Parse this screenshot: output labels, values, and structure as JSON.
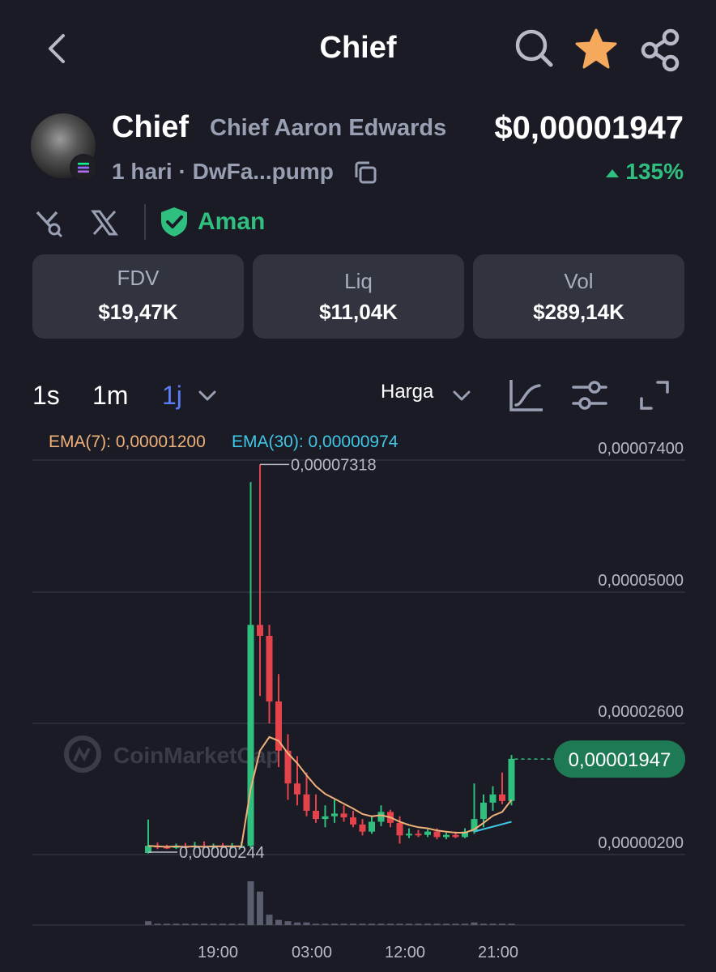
{
  "header": {
    "title": "Chief"
  },
  "token": {
    "symbol": "Chief",
    "name": "Chief Aaron Edwards",
    "price": "$0,00001947",
    "age": "1 hari",
    "separator": " · ",
    "address": "DwFa...pump",
    "change": "135%",
    "safety_label": "Aman"
  },
  "stats": [
    {
      "label": "FDV",
      "value": "$19,47K"
    },
    {
      "label": "Liq",
      "value": "$11,04K"
    },
    {
      "label": "Vol",
      "value": "$289,14K"
    }
  ],
  "intervals": [
    {
      "label": "1s",
      "active": false
    },
    {
      "label": "1m",
      "active": false
    },
    {
      "label": "1j",
      "active": true
    }
  ],
  "chart_type_label": "Harga",
  "ema": {
    "ema7": "EMA(7): 0,00001200",
    "ema30": "EMA(30): 0,00000974"
  },
  "colors": {
    "up": "#2fbf7e",
    "down": "#e4434c",
    "ema7": "#f0b07a",
    "ema30": "#3fc7e6",
    "accent": "#5b7cf7",
    "star": "#f4a95d",
    "badge": "#1e7a55"
  },
  "watermark": "CoinMarketCap",
  "icons": [
    "back-icon",
    "search-icon",
    "star-icon",
    "share-icon",
    "copy-icon",
    "audit-icon",
    "x-icon",
    "shield-check-icon",
    "chevron-down-icon",
    "line-chart-icon",
    "settings-sliders-icon",
    "expand-icon"
  ],
  "chart_data": {
    "type": "candlestick",
    "y_ticks": [
      "0,00007400",
      "0,00005000",
      "0,00002600",
      "0,00000200"
    ],
    "y_tick_values": [
      7.4e-05,
      5e-05,
      2.6e-05,
      2e-06
    ],
    "x_ticks": [
      "19:00",
      "03:00",
      "12:00",
      "21:00"
    ],
    "high_label": "0,00007318",
    "low_label": "0,00000244",
    "current_price_label": "0,00001947",
    "ylim": [
      2e-06,
      7.4e-05
    ],
    "candles": [
      {
        "o": 2.3e-06,
        "h": 8.4e-06,
        "l": 2.2e-06,
        "c": 3.6e-06,
        "v": 3
      },
      {
        "o": 3.6e-06,
        "h": 4.2e-06,
        "l": 3e-06,
        "c": 3.4e-06,
        "v": 1
      },
      {
        "o": 3.4e-06,
        "h": 3.8e-06,
        "l": 3e-06,
        "c": 3.3e-06,
        "v": 1
      },
      {
        "o": 3.3e-06,
        "h": 4e-06,
        "l": 3e-06,
        "c": 3.5e-06,
        "v": 1
      },
      {
        "o": 3.5e-06,
        "h": 4.1e-06,
        "l": 3.1e-06,
        "c": 3.3e-06,
        "v": 1
      },
      {
        "o": 3.3e-06,
        "h": 4.3e-06,
        "l": 3e-06,
        "c": 3.6e-06,
        "v": 1
      },
      {
        "o": 3.6e-06,
        "h": 4.4e-06,
        "l": 3.1e-06,
        "c": 3.3e-06,
        "v": 1
      },
      {
        "o": 3.3e-06,
        "h": 4e-06,
        "l": 3e-06,
        "c": 3.6e-06,
        "v": 1
      },
      {
        "o": 3.6e-06,
        "h": 4.1e-06,
        "l": 3.3e-06,
        "c": 3.5e-06,
        "v": 1
      },
      {
        "o": 3.5e-06,
        "h": 4.1e-06,
        "l": 3.1e-06,
        "c": 3.6e-06,
        "v": 1
      },
      {
        "o": 3.6e-06,
        "h": 4.3e-06,
        "l": 3.2e-06,
        "c": 3.6e-06,
        "v": 1
      },
      {
        "o": 3.6e-06,
        "h": 7e-05,
        "l": 3.2e-06,
        "c": 4.4e-05,
        "v": 34
      },
      {
        "o": 4.4e-05,
        "h": 7.32e-05,
        "l": 3.1e-05,
        "c": 4.2e-05,
        "v": 26
      },
      {
        "o": 4.2e-05,
        "h": 4.4e-05,
        "l": 2.6e-05,
        "c": 3e-05,
        "v": 8
      },
      {
        "o": 3e-05,
        "h": 3.5e-05,
        "l": 1.8e-05,
        "c": 2.1e-05,
        "v": 4
      },
      {
        "o": 2.1e-05,
        "h": 2.4e-05,
        "l": 1.2e-05,
        "c": 1.5e-05,
        "v": 3
      },
      {
        "o": 1.5e-05,
        "h": 2e-05,
        "l": 1.1e-05,
        "c": 1.3e-05,
        "v": 2
      },
      {
        "o": 1.3e-05,
        "h": 1.7e-05,
        "l": 9e-06,
        "c": 1e-05,
        "v": 2
      },
      {
        "o": 1e-05,
        "h": 1.3e-05,
        "l": 7.8e-06,
        "c": 8.5e-06,
        "v": 1
      },
      {
        "o": 8.5e-06,
        "h": 1.1e-05,
        "l": 7e-06,
        "c": 9e-06,
        "v": 1
      },
      {
        "o": 9e-06,
        "h": 1.2e-05,
        "l": 7.8e-06,
        "c": 9.5e-06,
        "v": 1
      },
      {
        "o": 9.5e-06,
        "h": 1.1e-05,
        "l": 8e-06,
        "c": 8.8e-06,
        "v": 1
      },
      {
        "o": 8.8e-06,
        "h": 1e-05,
        "l": 7e-06,
        "c": 7.5e-06,
        "v": 1
      },
      {
        "o": 7.5e-06,
        "h": 8.5e-06,
        "l": 5.5e-06,
        "c": 6.2e-06,
        "v": 1
      },
      {
        "o": 6.2e-06,
        "h": 9e-06,
        "l": 5.8e-06,
        "c": 8e-06,
        "v": 1
      },
      {
        "o": 8e-06,
        "h": 1.1e-05,
        "l": 7.2e-06,
        "c": 9.8e-06,
        "v": 1
      },
      {
        "o": 9.8e-06,
        "h": 1.02e-05,
        "l": 7e-06,
        "c": 7.8e-06,
        "v": 1
      },
      {
        "o": 7.8e-06,
        "h": 9e-06,
        "l": 4e-06,
        "c": 5.5e-06,
        "v": 1
      },
      {
        "o": 5.5e-06,
        "h": 6.8e-06,
        "l": 5e-06,
        "c": 5.8e-06,
        "v": 1
      },
      {
        "o": 5.8e-06,
        "h": 6.5e-06,
        "l": 5.2e-06,
        "c": 5.6e-06,
        "v": 1
      },
      {
        "o": 5.6e-06,
        "h": 6.6e-06,
        "l": 5.2e-06,
        "c": 6.2e-06,
        "v": 1
      },
      {
        "o": 6.2e-06,
        "h": 6.8e-06,
        "l": 4.8e-06,
        "c": 5.2e-06,
        "v": 1
      },
      {
        "o": 5.2e-06,
        "h": 6e-06,
        "l": 4.8e-06,
        "c": 5.6e-06,
        "v": 1
      },
      {
        "o": 5.6e-06,
        "h": 6.2e-06,
        "l": 5e-06,
        "c": 5.2e-06,
        "v": 1
      },
      {
        "o": 5.2e-06,
        "h": 6.8e-06,
        "l": 5e-06,
        "c": 6.2e-06,
        "v": 1
      },
      {
        "o": 6.2e-06,
        "h": 1.5e-05,
        "l": 5.8e-06,
        "c": 8.5e-06,
        "v": 2
      },
      {
        "o": 8.5e-06,
        "h": 1.3e-05,
        "l": 7e-06,
        "c": 1.15e-05,
        "v": 1
      },
      {
        "o": 1.15e-05,
        "h": 1.45e-05,
        "l": 1e-05,
        "c": 1.3e-05,
        "v": 1
      },
      {
        "o": 1.3e-05,
        "h": 1.7e-05,
        "l": 1.12e-05,
        "c": 1.18e-05,
        "v": 1
      },
      {
        "o": 1.18e-05,
        "h": 2.02e-05,
        "l": 1.1e-05,
        "c": 1.95e-05,
        "v": 1
      }
    ],
    "ema7_series": [
      3.6e-06,
      3.5e-06,
      3.4e-06,
      3.5e-06,
      3.4e-06,
      3.5e-06,
      3.4e-06,
      3.5e-06,
      3.5e-06,
      3.5e-06,
      3.5e-06,
      1.4e-05,
      2.1e-05,
      2.35e-05,
      2.28e-05,
      2.05e-05,
      1.87e-05,
      1.65e-05,
      1.45e-05,
      1.31e-05,
      1.22e-05,
      1.13e-05,
      1.04e-05,
      9.4e-06,
      9e-06,
      9.2e-06,
      8.8e-06,
      8e-06,
      7.4e-06,
      7e-06,
      6.8e-06,
      6.4e-06,
      6.2e-06,
      6e-06,
      6e-06,
      6.6e-06,
      7.8e-06,
      9.1e-06,
      9.8e-06,
      1.2e-05
    ]
  }
}
